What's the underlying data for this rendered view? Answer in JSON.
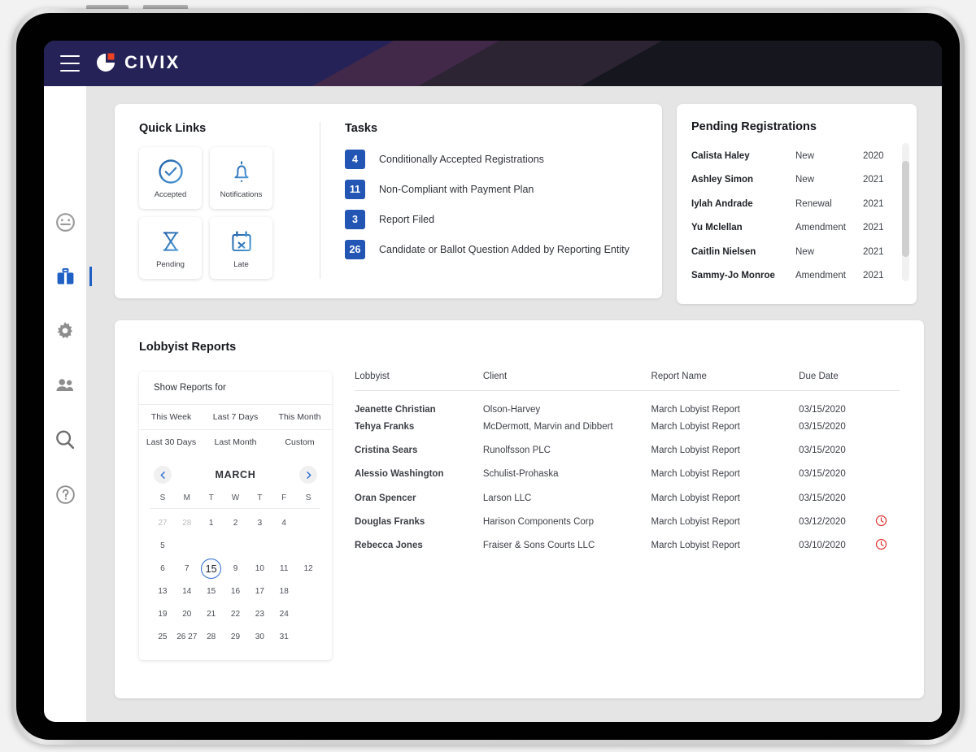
{
  "header": {
    "brand": "CIVIX",
    "menu_icon": "hamburger-menu-icon",
    "logo_icon": "civix-logo-icon",
    "bg_color": "#252258",
    "accent_color": "#ef4123"
  },
  "sidebar": {
    "items": [
      {
        "name": "dashboard",
        "icon": "gauge-icon",
        "active": false
      },
      {
        "name": "briefcase",
        "icon": "briefcase-icon",
        "active": true
      },
      {
        "name": "settings",
        "icon": "gear-icon",
        "active": false
      },
      {
        "name": "people",
        "icon": "people-icon",
        "active": false
      },
      {
        "name": "search",
        "icon": "search-icon",
        "active": false
      },
      {
        "name": "help",
        "icon": "help-circle-icon",
        "active": false
      }
    ]
  },
  "quick_links": {
    "title": "Quick Links",
    "tiles": [
      {
        "label": "Accepted",
        "icon": "check-circle-icon"
      },
      {
        "label": "Notifications",
        "icon": "bell-icon"
      },
      {
        "label": "Pending",
        "icon": "hourglass-icon"
      },
      {
        "label": "Late",
        "icon": "calendar-x-icon"
      }
    ]
  },
  "tasks": {
    "title": "Tasks",
    "badge_color": "#2255b4",
    "items": [
      {
        "count": "4",
        "label": "Conditionally Accepted Registrations"
      },
      {
        "count": "11",
        "label": "Non-Compliant with Payment Plan"
      },
      {
        "count": "3",
        "label": "Report Filed"
      },
      {
        "count": "26",
        "label": "Candidate or Ballot Question Added by Reporting Entity"
      }
    ]
  },
  "pending_registrations": {
    "title": "Pending Registrations",
    "rows": [
      {
        "name": "Calista Haley",
        "type": "New",
        "year": "2020"
      },
      {
        "name": "Ashley Simon",
        "type": "New",
        "year": "2021"
      },
      {
        "name": "Iylah Andrade",
        "type": "Renewal",
        "year": "2021"
      },
      {
        "name": "Yu Mclellan",
        "type": "Amendment",
        "year": "2021"
      },
      {
        "name": "Caitlin Nielsen",
        "type": "New",
        "year": "2021"
      },
      {
        "name": "Sammy-Jo Monroe",
        "type": "Amendment",
        "year": "2021"
      }
    ]
  },
  "lobbyist_reports": {
    "title": "Lobbyist Reports",
    "filter": {
      "label": "Show Reports for",
      "options_row1": [
        "This Week",
        "Last 7 Days",
        "This Month"
      ],
      "options_row2": [
        "Last 30 Days",
        "Last Month",
        "Custom"
      ]
    },
    "calendar": {
      "month": "MARCH",
      "prev_icon": "chevron-left-icon",
      "next_icon": "chevron-right-icon",
      "weekdays": [
        "S",
        "M",
        "T",
        "W",
        "T",
        "F",
        "S"
      ],
      "selected_day": "15",
      "weeks": [
        [
          {
            "d": "27",
            "muted": true
          },
          {
            "d": "28",
            "muted": true
          },
          {
            "d": "1"
          },
          {
            "d": "2"
          },
          {
            "d": "3"
          },
          {
            "d": "4"
          },
          {
            "d": ""
          }
        ],
        [
          {
            "d": "5"
          },
          {
            "d": ""
          },
          {
            "d": ""
          },
          {
            "d": ""
          },
          {
            "d": ""
          },
          {
            "d": ""
          },
          {
            "d": ""
          }
        ],
        [
          {
            "d": "6"
          },
          {
            "d": "7"
          },
          {
            "d": "15",
            "selected": true
          },
          {
            "d": "9"
          },
          {
            "d": "10"
          },
          {
            "d": "11"
          },
          {
            "d": "12"
          }
        ],
        [
          {
            "d": "13"
          },
          {
            "d": "14"
          },
          {
            "d": "15"
          },
          {
            "d": "16"
          },
          {
            "d": "17"
          },
          {
            "d": "18"
          },
          {
            "d": ""
          }
        ],
        [
          {
            "d": "19"
          },
          {
            "d": "20"
          },
          {
            "d": "21"
          },
          {
            "d": "22"
          },
          {
            "d": "23"
          },
          {
            "d": "24"
          },
          {
            "d": ""
          }
        ],
        [
          {
            "d": "25"
          },
          {
            "d": "26 27"
          },
          {
            "d": "28"
          },
          {
            "d": "29"
          },
          {
            "d": "30"
          },
          {
            "d": "31"
          },
          {
            "d": ""
          }
        ]
      ]
    },
    "table": {
      "columns": [
        "Lobbyist",
        "Client",
        "Report Name",
        "Due Date"
      ],
      "overdue_color": "#e23636",
      "rows": [
        {
          "lobbyist": "Jeanette Christian",
          "client": "Olson-Harvey",
          "report": "March Lobyist Report",
          "due": "03/15/2020",
          "overdue": false
        },
        {
          "lobbyist": "Tehya Franks",
          "client": "McDermott, Marvin and Dibbert",
          "report": "March Lobyist Report",
          "due": "03/15/2020",
          "overdue": false
        },
        {
          "lobbyist": "Cristina Sears",
          "client": "Runolfsson PLC",
          "report": "March Lobyist Report",
          "due": "03/15/2020",
          "overdue": false
        },
        {
          "lobbyist": "Alessio Washington",
          "client": "Schulist-Prohaska",
          "report": "March Lobyist Report",
          "due": "03/15/2020",
          "overdue": false
        },
        {
          "lobbyist": "Oran Spencer",
          "client": "Larson LLC",
          "report": "March Lobyist Report",
          "due": "03/15/2020",
          "overdue": false
        },
        {
          "lobbyist": "Douglas Franks",
          "client": "Harison Components Corp",
          "report": "March Lobyist Report",
          "due": "03/12/2020",
          "overdue": true
        },
        {
          "lobbyist": "Rebecca Jones",
          "client": "Fraiser & Sons Courts LLC",
          "report": "March Lobyist Report",
          "due": "03/10/2020",
          "overdue": true
        }
      ]
    }
  }
}
